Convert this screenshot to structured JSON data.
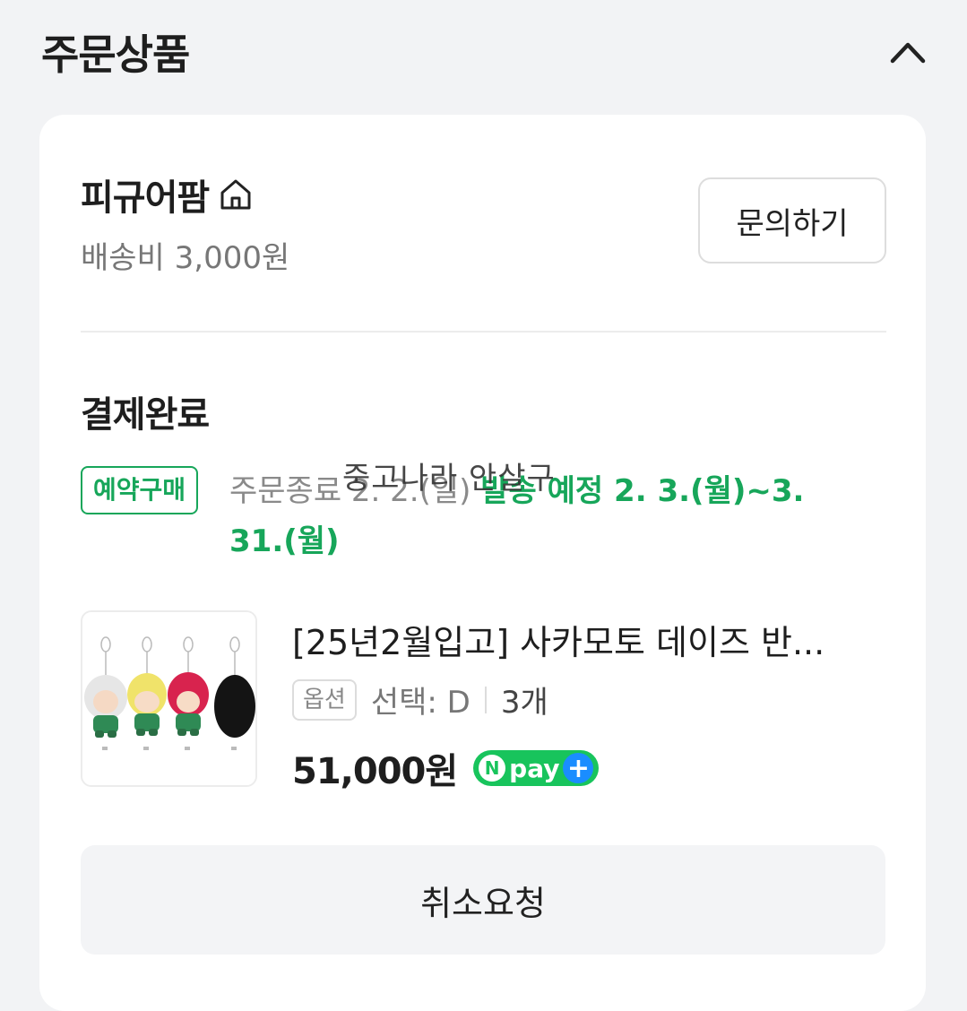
{
  "section": {
    "title": "주문상품"
  },
  "store": {
    "name": "피규어팜",
    "shipping": "배송비 3,000원",
    "inquiry_label": "문의하기"
  },
  "order": {
    "status": "결제완료",
    "badge": "예약구매",
    "order_end": "주문종료 2. 2.(일)",
    "shipping_plan": "발송 예정 2. 3.(월)~3. 31.(월)",
    "watermark": "중고나라 안살구"
  },
  "product": {
    "title": "[25년2월입고] 사카모토 데이즈 반...",
    "option_tag": "옵션",
    "option_value": "선택: D",
    "quantity": "3개",
    "price": "51,000원",
    "npay_n": "N",
    "npay_label": "pay",
    "npay_plus": "+"
  },
  "actions": {
    "cancel_label": "취소요청"
  },
  "colors": {
    "accent_green": "#17a65a",
    "npay_green": "#18c45c",
    "npay_blue": "#1a8dff"
  }
}
